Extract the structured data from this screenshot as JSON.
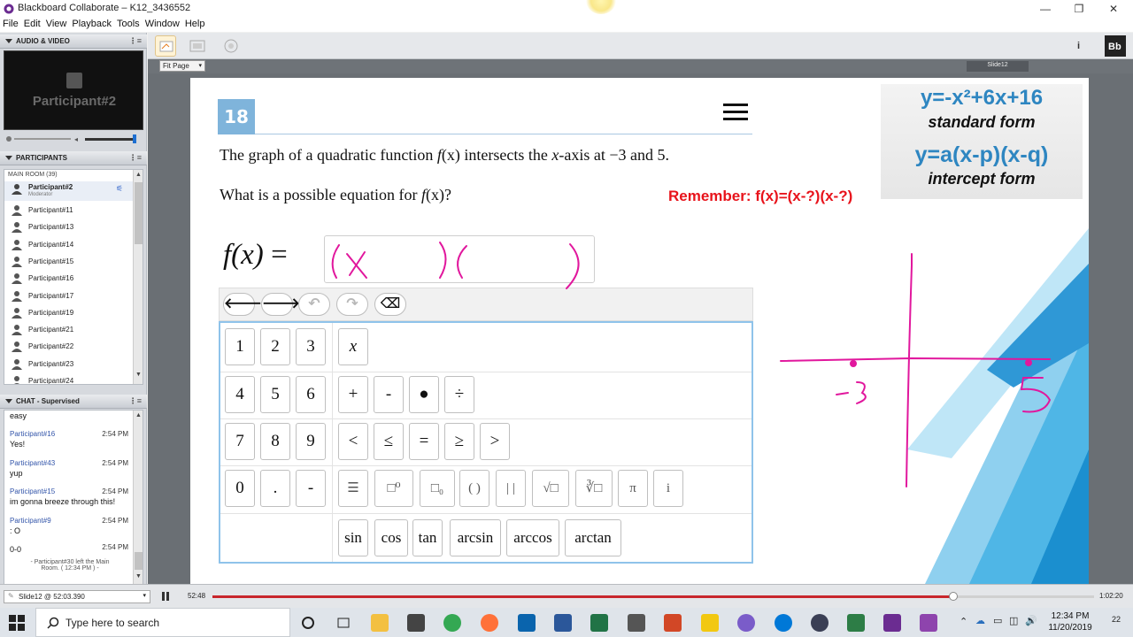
{
  "window": {
    "title": "Blackboard Collaborate – K12_3436552",
    "minimize_label": "—",
    "maximize_label": "❐",
    "close_label": "✕"
  },
  "menu": [
    "File",
    "Edit",
    "View",
    "Playback",
    "Tools",
    "Window",
    "Help"
  ],
  "audio_video": {
    "header": "AUDIO & VIDEO",
    "participant_label": "Participant#2"
  },
  "participants": {
    "header": "PARTICIPANTS",
    "room": "MAIN ROOM (39)",
    "moderator": {
      "name": "Participant#2",
      "role": "Moderator"
    },
    "list": [
      "Participant#11",
      "Participant#13",
      "Participant#14",
      "Participant#15",
      "Participant#16",
      "Participant#17",
      "Participant#19",
      "Participant#21",
      "Participant#22",
      "Participant#23",
      "Participant#24"
    ]
  },
  "chat": {
    "header": "CHAT - Supervised",
    "top_text": "easy",
    "messages": [
      {
        "from": "Participant#16",
        "time": "2:54 PM",
        "text": "Yes!"
      },
      {
        "from": "Participant#43",
        "time": "2:54 PM",
        "text": "yup"
      },
      {
        "from": "Participant#15",
        "time": "2:54 PM",
        "text": "im gonna breeze through this!"
      },
      {
        "from": "Participant#9",
        "time": "2:54 PM",
        "text": ": O"
      },
      {
        "from": "",
        "time": "2:54 PM",
        "text": "0-0"
      }
    ],
    "system_line1": "- Participant#30 left the Main",
    "system_line2": "Room. ( 12:34 PM ) -"
  },
  "toolbar": {
    "fit_page": "Fit Page",
    "slide_label": "Slide12"
  },
  "slide": {
    "question_number": "18",
    "q_line1_a": "The graph of a quadratic function ",
    "q_line1_fx": "f",
    "q_line1_b": "(x) intersects the ",
    "q_line1_xi": "x",
    "q_line1_c": "-axis at −3 and 5.",
    "q_line2_a": "What is a possible equation for ",
    "q_line2_f": "f",
    "q_line2_b": "(x)?",
    "remember": "Remember: f(x)=(x-?)(x-?)",
    "fx_f": "f",
    "fx_x": "(x)",
    "fx_eq": "=",
    "standard_eq": "y=-x²+6x+16",
    "standard_label": "standard form",
    "intercept_eq": "y=a(x-p)(x-q)",
    "intercept_label": "intercept form"
  },
  "keypad": {
    "digits_row1": [
      "1",
      "2",
      "3"
    ],
    "digits_row2": [
      "4",
      "5",
      "6"
    ],
    "digits_row3": [
      "7",
      "8",
      "9"
    ],
    "digits_row4": [
      "0",
      ".",
      "-"
    ],
    "var_x": "x",
    "ops_row2": [
      "+",
      "-",
      "●",
      "÷"
    ],
    "ops_row3": [
      "<",
      "≤",
      "=",
      "≥",
      ">"
    ],
    "special_row4": [
      "☰",
      "□⁰",
      "□₀",
      "( )",
      "| |",
      "√□",
      "∛□",
      "π",
      "i"
    ],
    "trig": [
      "sin",
      "cos",
      "tan",
      "arcsin",
      "arccos",
      "arctan"
    ]
  },
  "annotations": {
    "left_root": "-3",
    "right_root": "5"
  },
  "playback": {
    "slide_position": "Slide12 @ 52:03.390",
    "current_time": "52:48",
    "total_time": "1:02:20",
    "progress": 0.84
  },
  "taskbar": {
    "search_placeholder": "Type here to search",
    "time": "12:34 PM",
    "date": "11/20/2019",
    "notifications": "22"
  },
  "colors": {
    "accent_blue": "#7fb4db",
    "remember_red": "#e8131b",
    "ink_magenta": "#e1179d",
    "formula_blue": "#2e86c1"
  }
}
